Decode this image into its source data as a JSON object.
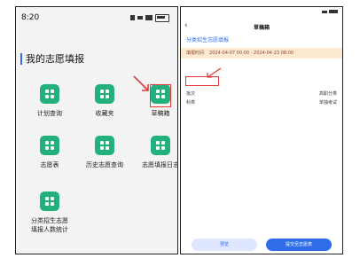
{
  "left": {
    "status_time": "8:20",
    "battery": "",
    "page_title": "我的志愿填报",
    "tiles": [
      {
        "label": "计划查询"
      },
      {
        "label": "收藏夹"
      },
      {
        "label": "草稿箱"
      },
      {
        "label": "志愿表"
      },
      {
        "label": "历史志愿查询"
      },
      {
        "label": "志愿填报日志"
      },
      {
        "label": "分类招生志愿",
        "label2": "填报人数统计"
      }
    ],
    "highlight_color": "#e03a3a",
    "tile_color": "#22b07d"
  },
  "right": {
    "status_time": "",
    "header_title": "草稿箱",
    "back_icon": "chevron-left",
    "section_title": "分类招生志愿填报",
    "time_label": "填报时间",
    "time_value": "2024-04-07 00:00 - 2024-04-23 08:00",
    "status_chip": "",
    "rows": [
      {
        "key": "批次",
        "value": "高职分类"
      },
      {
        "key": "科类",
        "value": "单独考试"
      }
    ],
    "buttons": {
      "secondary": "预览",
      "primary": "提交至志愿表"
    }
  }
}
